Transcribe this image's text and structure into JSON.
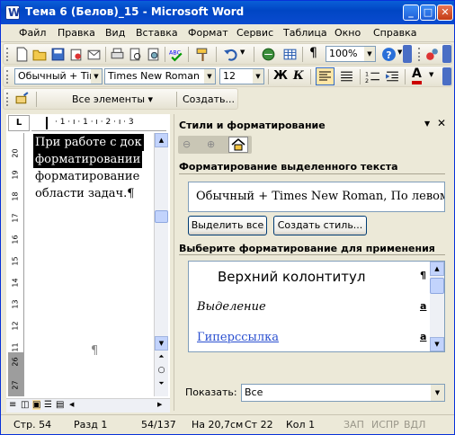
{
  "window": {
    "title": "Тема 6 (Белов)_15 - Microsoft Word"
  },
  "menu": [
    "Файл",
    "Правка",
    "Вид",
    "Вставка",
    "Формат",
    "Сервис",
    "Таблица",
    "Окно",
    "Справка"
  ],
  "standard_toolbar": {
    "zoom": "100%"
  },
  "formatting_toolbar": {
    "style": "Обычный + Time",
    "font": "Times New Roman",
    "size": "12",
    "bold": "Ж",
    "italic": "К"
  },
  "reviewing_toolbar": {
    "show_label": "Все элементы ▾",
    "create_label": "Создать..."
  },
  "ruler": {
    "h_labels": "· 1 · ı · 1 · ı · 2 · ı · 3",
    "v_labels": [
      "20",
      "19",
      "18",
      "17",
      "16",
      "15",
      "14",
      "13",
      "12",
      "11",
      "26",
      "27"
    ]
  },
  "document": {
    "line1": "При работе с док",
    "line2": "форматировании",
    "line3": "форматирование",
    "line4": "области задач.¶",
    "pilcrow": "¶"
  },
  "task_pane": {
    "title": "Стили и форматирование",
    "section_selected": "Форматирование выделенного текста",
    "current_format": "Обычный + Times New Roman, По левом",
    "select_all_button": "Выделить все",
    "create_style_button": "Создать стиль...",
    "section_apply": "Выберите форматирование для применения",
    "styles": [
      {
        "name": "Верхний колонтитул",
        "mark": "¶"
      },
      {
        "name": "Выделение",
        "mark": "a"
      },
      {
        "name": "Гиперссылка",
        "mark": "a"
      }
    ],
    "show_label": "Показать:",
    "show_value": "Все"
  },
  "status": {
    "page": "Стр. 54",
    "section": "Разд 1",
    "pages": "54/137",
    "at": "На 20,7см",
    "line": "Ст 22",
    "col": "Кол 1",
    "rec": "ЗАП",
    "trk": "ИСПР",
    "ext": "ВДЛ"
  }
}
